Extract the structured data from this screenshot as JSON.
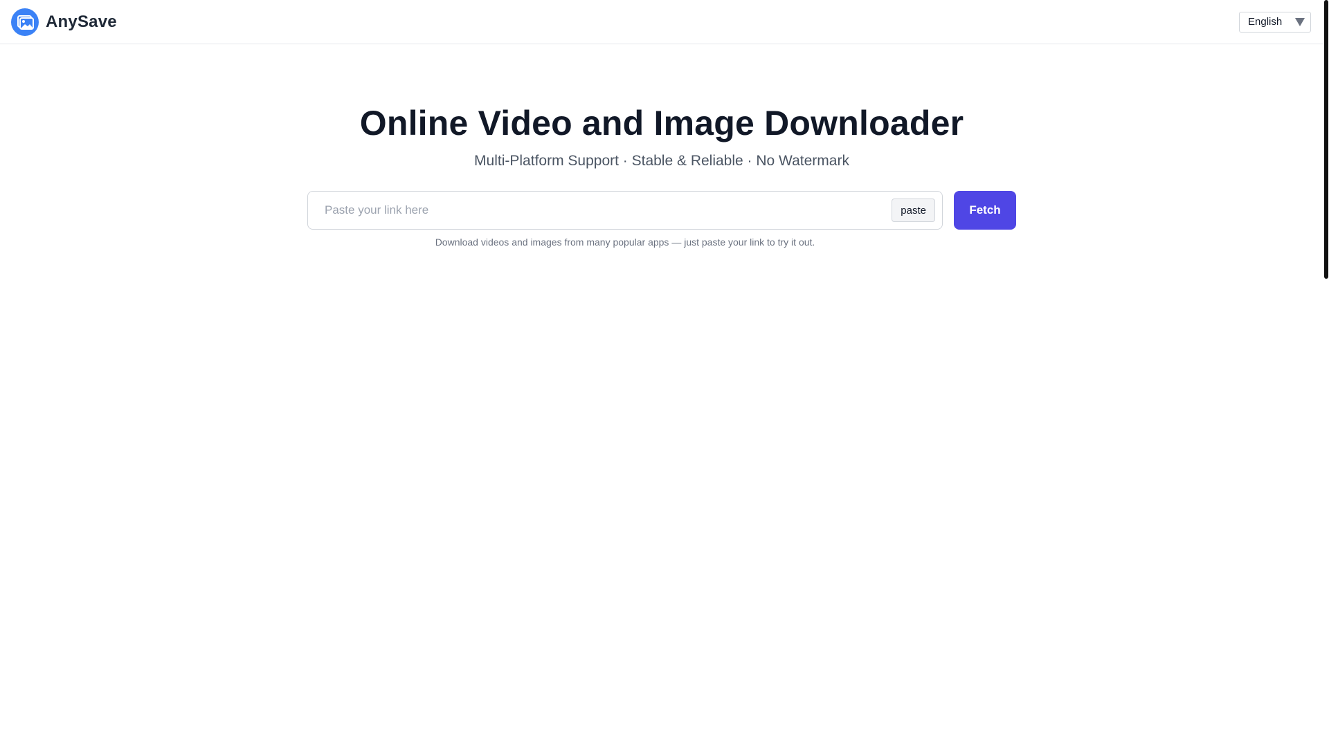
{
  "header": {
    "brand_name": "AnySave",
    "logo_icon": "image-gallery-icon",
    "language": {
      "selected": "English"
    }
  },
  "hero": {
    "title": "Online Video and Image Downloader",
    "subtitle": "Multi-Platform Support · Stable & Reliable · No Watermark"
  },
  "search": {
    "value": "",
    "placeholder": "Paste your link here",
    "paste_label": "paste",
    "fetch_label": "Fetch",
    "helper": "Download videos and images from many popular apps — just paste your link to try it out."
  },
  "colors": {
    "accent": "#4f46e5",
    "logo_bg": "#3b82f6",
    "title": "#111827",
    "muted": "#6b7280"
  }
}
